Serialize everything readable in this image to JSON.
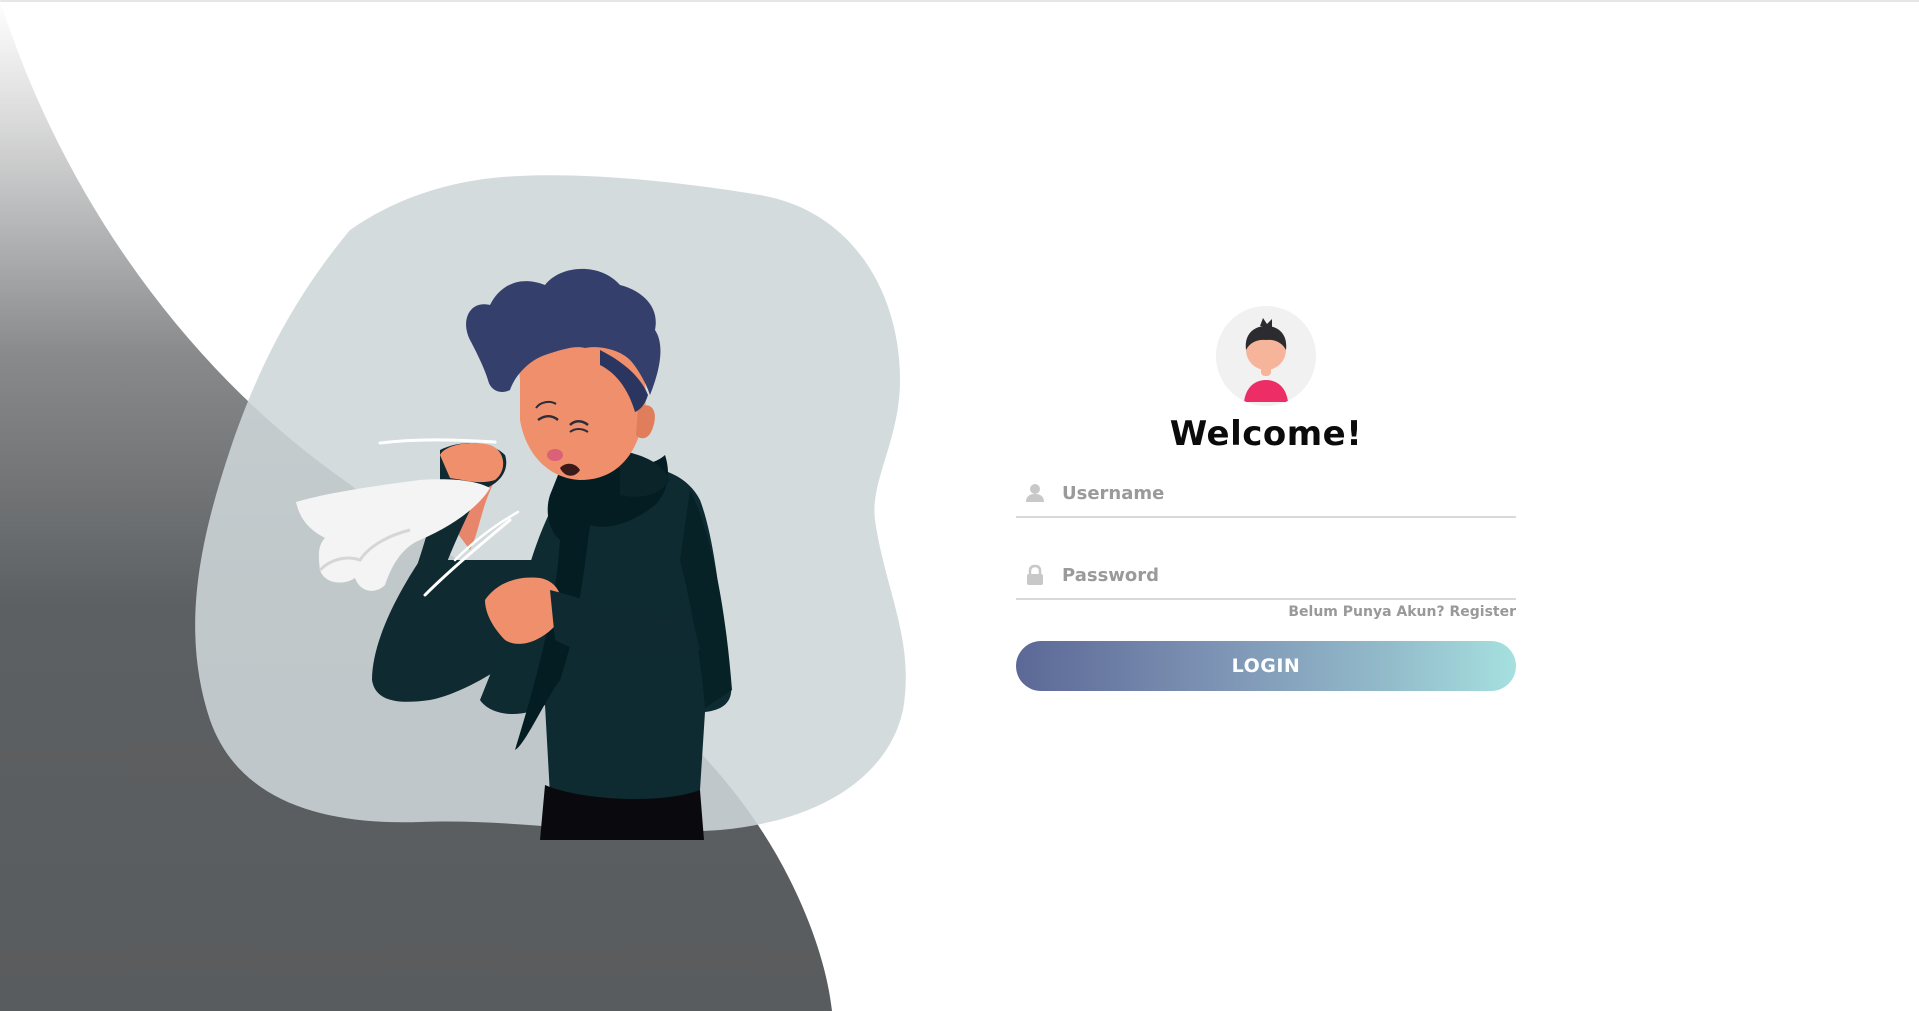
{
  "login": {
    "title": "Welcome!",
    "username_placeholder": "Username",
    "password_placeholder": "Password",
    "register_text": "Belum Punya Akun? Register",
    "login_label": "LOGIN"
  },
  "colors": {
    "wave_top": "#ffffff",
    "wave_bottom": "#5a5d60",
    "blob": "#d3dadc",
    "button_gradient_start": "#5c6896",
    "button_gradient_end": "#a6e0df",
    "hair": "#35416b",
    "skin": "#f08f6c",
    "jacket": "#0f2a30"
  },
  "icons": {
    "username": "user-icon",
    "password": "lock-icon",
    "avatar": "user-avatar"
  }
}
